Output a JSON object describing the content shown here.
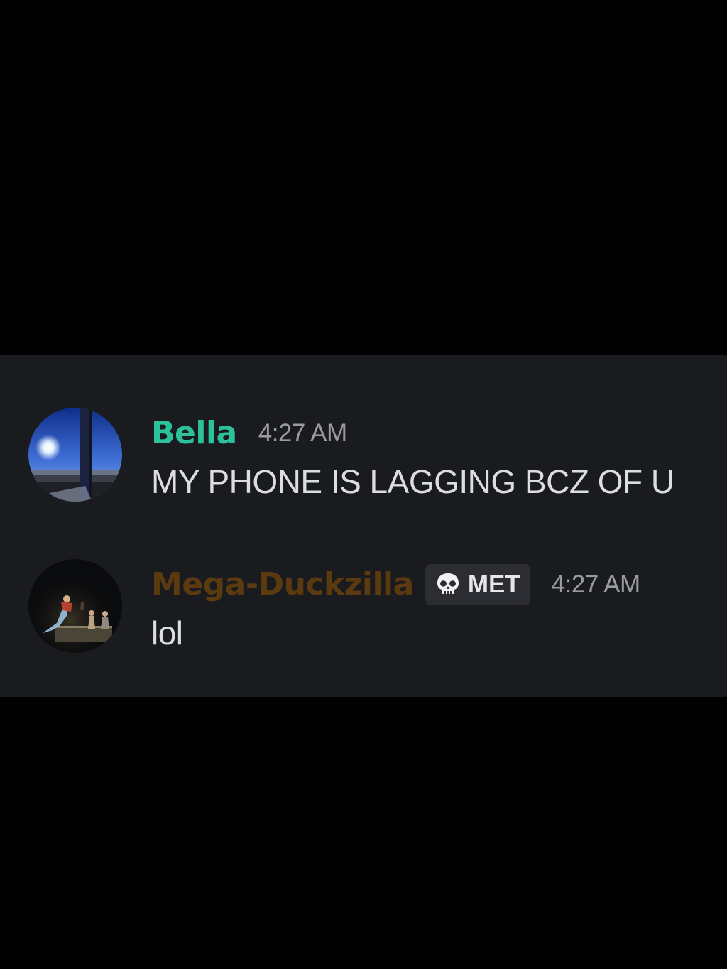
{
  "messages": [
    {
      "username": "Bella",
      "username_color": "#2bc29b",
      "timestamp": "4:27 AM",
      "content": "MY PHONE IS LAGGING BCZ OF U",
      "avatar_icon": "avatar-photo"
    },
    {
      "username": "Mega-Duckzilla",
      "username_color": "#5a3a0e",
      "badge": {
        "icon": "skull-icon",
        "label": "MET"
      },
      "timestamp": "4:27 AM",
      "content": "lol",
      "avatar_icon": "avatar-photo"
    }
  ],
  "colors": {
    "panel_background": "#1a1b1e",
    "outer_background": "#000000",
    "timestamp": "#9a9ba2",
    "message_text": "#dcdde1",
    "badge_background": "#2c2d33"
  }
}
